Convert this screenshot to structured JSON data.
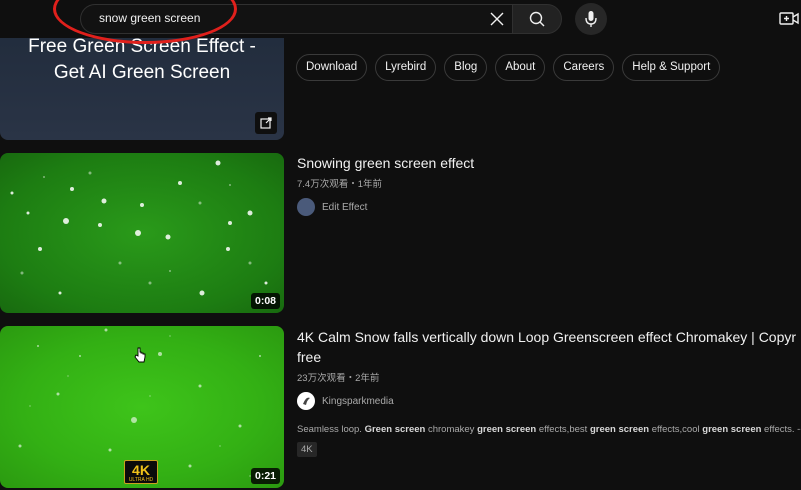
{
  "search": {
    "value": "snow green screen"
  },
  "ad": {
    "title_line1": "Free Green Screen Effect -",
    "title_line2": "Get AI Green Screen",
    "chips": [
      "Download",
      "Lyrebird",
      "Blog",
      "About",
      "Careers",
      "Help & Support"
    ]
  },
  "videos": [
    {
      "title": "Snowing green screen effect",
      "meta": "7.4万次观看・1年前",
      "channel": "Edit Effect",
      "duration": "0:08"
    },
    {
      "title_line1": "4K Calm Snow falls vertically down Loop Greenscreen effect Chromakey | Copyr",
      "title_line2": "free",
      "meta": "23万次观看・2年前",
      "channel": "Kingsparkmedia",
      "duration": "0:21",
      "badge_big": "4K",
      "badge_small": "ULTRA HD",
      "desc_parts": [
        "Seamless loop. ",
        "Green screen",
        " chromakey ",
        "green screen",
        " effects,best ",
        "green screen",
        " effects,cool ",
        "green screen",
        " effects. ----"
      ],
      "tag": "4K"
    }
  ],
  "icons": [
    "clear-icon",
    "search-icon",
    "mic-icon",
    "create-video-icon",
    "open-external-icon",
    "mouse-cursor-icon"
  ],
  "colors": {
    "annotation": "#e0201c",
    "background": "#0f0f0f",
    "badge_gold": "#f0c21a"
  }
}
